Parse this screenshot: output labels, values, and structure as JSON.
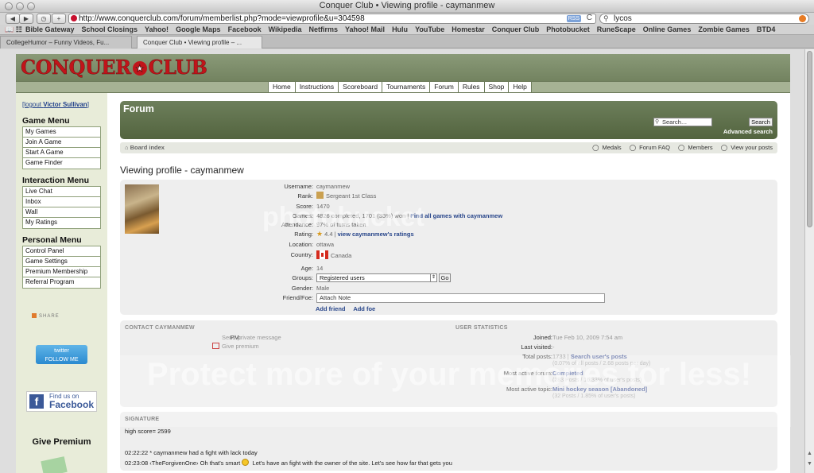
{
  "window": {
    "title": "Conquer Club • Viewing profile - caymanmew"
  },
  "toolbar": {
    "back_label": "◀",
    "forward_label": "▶",
    "history_label": "◷",
    "add_label": "+",
    "url": "http://www.conquerclub.com/forum/memberlist.php?mode=viewprofile&u=304598",
    "rss_label": "RSS",
    "reload_label": "C",
    "search_value": "lycos"
  },
  "bookmarks": {
    "items": [
      "Bible Gateway",
      "School Closings",
      "Yahoo!",
      "Google Maps",
      "Facebook",
      "Wikipedia",
      "Netfirms",
      "Yahoo! Mail",
      "Hulu",
      "YouTube",
      "Homestar",
      "Conquer Club",
      "Photobucket",
      "RuneScape",
      "Online Games",
      "Zombie Games",
      "BTD4"
    ]
  },
  "tabs": [
    {
      "label": "CollegeHumor – Funny Videos, Fu..."
    },
    {
      "label": "Conquer Club • Viewing profile – ..."
    }
  ],
  "site": {
    "logo_left": "CONQUER",
    "logo_star": "★",
    "logo_right": "CLUB",
    "topnav": [
      "Home",
      "Instructions",
      "Scoreboard",
      "Tournaments",
      "Forum",
      "Rules",
      "Shop",
      "Help"
    ]
  },
  "sidebar": {
    "logout_prefix": "[logout ",
    "logout_user": "Victor Sullivan",
    "logout_suffix": "]",
    "game_menu_title": "Game Menu",
    "game_menu": [
      "My Games",
      "Join A Game",
      "Start A Game",
      "Game Finder"
    ],
    "interaction_menu_title": "Interaction Menu",
    "interaction_menu": [
      "Live Chat",
      "Inbox",
      "Wall",
      "My Ratings"
    ],
    "personal_menu_title": "Personal Menu",
    "personal_menu": [
      "Control Panel",
      "Game Settings",
      "Premium Membership",
      "Referral Program"
    ],
    "share_label": "SHARE",
    "twitter_line1": "twitter",
    "twitter_line2": "FOLLOW ME",
    "facebook_line1": "Find us on",
    "facebook_line2": "Facebook",
    "give_premium": "Give Premium"
  },
  "forum": {
    "title": "Forum",
    "search_placeholder": "Search…",
    "search_button": "Search",
    "advanced_search": "Advanced search",
    "board_index": "Board index",
    "links": [
      "Medals",
      "Forum FAQ",
      "Members",
      "View your posts"
    ],
    "page_title": "Viewing profile - caymanmew"
  },
  "profile": {
    "username_label": "Username:",
    "username": "caymanmew",
    "rank_label": "Rank:",
    "rank": "Sergeant 1st Class",
    "score_label": "Score:",
    "score": "1470",
    "games_label": "Games:",
    "games": "4826 completed, 1701 (35%) won",
    "games_link": "Find all games with caymanmew",
    "attendance_label": "Attendance:",
    "attendance": "97% of turns taken",
    "rating_label": "Rating:",
    "rating": "4.4",
    "rating_link": "view caymanmew's ratings",
    "location_label": "Location:",
    "location": "ottawa",
    "country_label": "Country:",
    "country": "Canada",
    "age_label": "Age:",
    "age": "14",
    "groups_label": "Groups:",
    "groups_selected": "Registered users",
    "go_button": "Go",
    "gender_label": "Gender:",
    "gender": "Male",
    "friendfoe_label": "Friend/Foe:",
    "note_value": "Attach Note",
    "add_friend": "Add friend",
    "add_foe": "Add foe"
  },
  "contact": {
    "title": "CONTACT CAYMANMEW",
    "pm_label": "PM:",
    "pm_value": "Send private message",
    "give_premium": "Give premium"
  },
  "stats": {
    "title": "USER STATISTICS",
    "joined_label": "Joined:",
    "joined": "Tue Feb 10, 2009 7:54 am",
    "last_visited_label": "Last visited:",
    "last_visited": "-",
    "total_posts_label": "Total posts:",
    "total_posts": "1733",
    "total_posts_link": "Search user's posts",
    "total_posts_sub": "(0.07% of all posts / 2.68 posts per day)",
    "active_forum_label": "Most active forum:",
    "active_forum": "Completed",
    "active_forum_sub": "(283 Posts / 16.33% of user's posts)",
    "active_topic_label": "Most active topic:",
    "active_topic": "Mini hockey season [Abandoned]",
    "active_topic_sub": "(32 Posts / 1.85% of user's posts)"
  },
  "signature": {
    "title": "SIGNATURE",
    "line1": "high score= 2599",
    "line2": "02:22:22 * caymanmew had a fight with lack today",
    "line3_a": "02:23:08 ‹TheForgivenOne› Oh that's smart",
    "line3_b": "Let's have an fight with the owner of the site. Let's see how far that gets you"
  },
  "watermark": {
    "logo": "photobucket",
    "text": "Protect more of your memories for less!"
  }
}
